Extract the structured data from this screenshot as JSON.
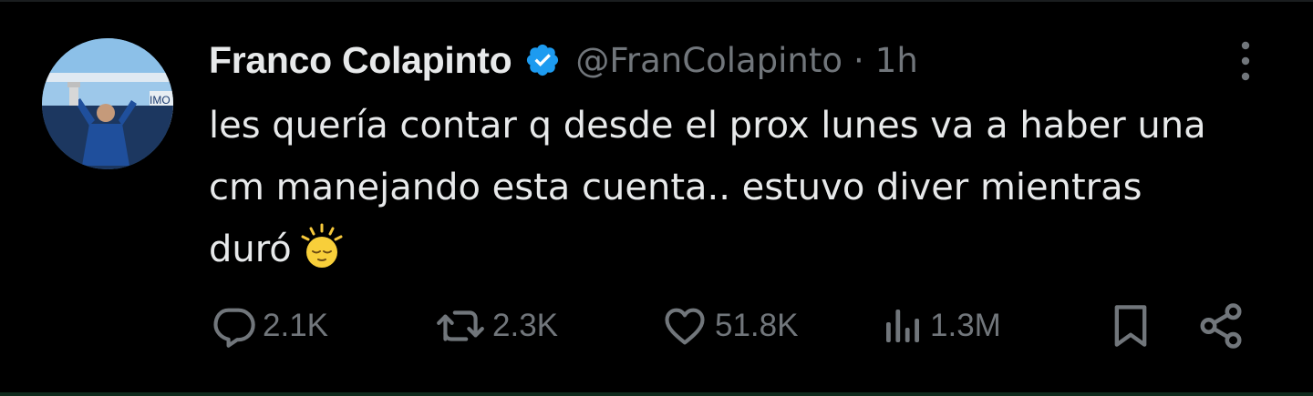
{
  "tweet": {
    "author": {
      "display_name": "Franco Colapinto",
      "handle": "@FranColapinto",
      "verified": true,
      "avatar_icon": "avatar-racing-driver"
    },
    "separator": "·",
    "timestamp": "1h",
    "text_lines": [
      "les quería contar q desde el prox lunes va a haber una",
      "cm manejando esta cuenta.. estuvo diver mientras",
      "duró"
    ],
    "emoji": "sun-behind-face-emoji",
    "more_icon": "more-vertical-icon",
    "actions": {
      "reply": {
        "icon": "reply-icon",
        "count": "2.1K"
      },
      "retweet": {
        "icon": "retweet-icon",
        "count": "2.3K"
      },
      "like": {
        "icon": "heart-icon",
        "count": "51.8K"
      },
      "views": {
        "icon": "views-icon",
        "count": "1.3M"
      },
      "bookmark": {
        "icon": "bookmark-icon"
      },
      "share": {
        "icon": "share-icon"
      }
    },
    "colors": {
      "background": "#000000",
      "text_primary": "#e7e9ea",
      "text_secondary": "#71767b",
      "verified_blue": "#1d9bf0"
    }
  }
}
